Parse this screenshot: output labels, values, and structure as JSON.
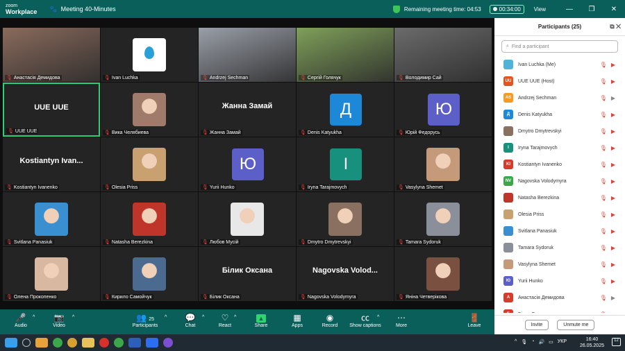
{
  "window": {
    "logo_line1": "zoom",
    "logo_line2": "Workplace",
    "meeting_title": "Meeting 40-Minutes",
    "remaining_label": "Remaining meeting time: 04:53",
    "elapsed": "00:34:00",
    "view_label": "View"
  },
  "tiles": [
    {
      "name": "Анастасія Демидова",
      "type": "video",
      "bg": "#8a6b5c"
    },
    {
      "name": "Ivan Luchka",
      "type": "logo",
      "bg": "#ffffff"
    },
    {
      "name": "Andrzej Sechman",
      "type": "video",
      "bg": "#9a9fa8"
    },
    {
      "name": "Сергій Голячук",
      "type": "video",
      "bg": "#7fa05a"
    },
    {
      "name": "Володимир Сай",
      "type": "video",
      "bg": "#6b6b6b"
    },
    {
      "name": "UUE UUE",
      "type": "text",
      "big": "UUE UUE",
      "active": true
    },
    {
      "name": "Вика Челябиева",
      "type": "photo",
      "bg": "#a07a6a"
    },
    {
      "name": "Жанна Замай",
      "type": "text",
      "big": "Жанна Замай"
    },
    {
      "name": "Denis Katyukha",
      "type": "letter",
      "letter": "Д",
      "bg": "#1e88d8"
    },
    {
      "name": "Юрій Федорусь",
      "type": "letter",
      "letter": "Ю",
      "bg": "#5b5fc7"
    },
    {
      "name": "Kostiantyn Ivanenko",
      "type": "text",
      "big": "Kostiantyn  Ivan..."
    },
    {
      "name": "Olesia Priss",
      "type": "photo",
      "bg": "#c9a070"
    },
    {
      "name": "Yurii Hunko",
      "type": "letter",
      "letter": "Ю",
      "bg": "#5b5fc7"
    },
    {
      "name": "Iryna Tarajmovych",
      "type": "letter",
      "letter": "І",
      "bg": "#17907e"
    },
    {
      "name": "Vasylyna Shemet",
      "type": "photo",
      "bg": "#c49a7a"
    },
    {
      "name": "Svitlana Panasiuk",
      "type": "photo",
      "bg": "#3a8fd0"
    },
    {
      "name": "Natasha Berezkina",
      "type": "photo",
      "bg": "#c0352a"
    },
    {
      "name": "Любов Мусій",
      "type": "photo",
      "bg": "#e8e8e8"
    },
    {
      "name": "Dmytro Dmytrevskyi",
      "type": "photo",
      "bg": "#8a7060"
    },
    {
      "name": "Tamara Sydoruk",
      "type": "photo",
      "bg": "#8a8f99"
    },
    {
      "name": "Олена Прокопенко",
      "type": "photo",
      "bg": "#d8b8a0"
    },
    {
      "name": "Кирило Самойчук",
      "type": "photo",
      "bg": "#4a6a90"
    },
    {
      "name": "Білик Оксана",
      "type": "text",
      "big": "Білик Оксана"
    },
    {
      "name": "Nagovska Volodymyra",
      "type": "text",
      "big": "Nagovska  Volod..."
    },
    {
      "name": "Яніна Четверікова",
      "type": "photo",
      "bg": "#7a5040"
    }
  ],
  "toolbar": {
    "audio": "Audio",
    "video": "Video",
    "participants": "Participants",
    "participants_count": "25",
    "chat": "Chat",
    "react": "React",
    "share": "Share",
    "apps": "Apps",
    "record": "Record",
    "captions": "Show captions",
    "more": "More",
    "leave": "Leave"
  },
  "panel": {
    "title": "Participants (25)",
    "search_placeholder": "Find a participant",
    "invite": "Invite",
    "unmute_me": "Unmute me",
    "participants": [
      {
        "name": "Ivan Luchka (Me)",
        "abbr": "",
        "color": "#4fb3d9",
        "video": "off"
      },
      {
        "name": "UUE UUE (Host)",
        "abbr": "UU",
        "color": "#e2551f",
        "video": "off"
      },
      {
        "name": "Andrzej Sechman",
        "abbr": "AS",
        "color": "#f59a23",
        "video": "on"
      },
      {
        "name": "Denis Katyukha",
        "abbr": "Д",
        "color": "#1e88d8",
        "video": "off"
      },
      {
        "name": "Dmytro Dmytrevskyi",
        "abbr": "",
        "color": "#8a7060",
        "video": "off"
      },
      {
        "name": "Iryna Tarajmovych",
        "abbr": "І",
        "color": "#17907e",
        "video": "off"
      },
      {
        "name": "Kostiantyn Ivanenko",
        "abbr": "KI",
        "color": "#d63a2a",
        "video": "off"
      },
      {
        "name": "Nagovska Volodymyra",
        "abbr": "NV",
        "color": "#3aa84a",
        "video": "off"
      },
      {
        "name": "Natasha Berezkina",
        "abbr": "",
        "color": "#c0352a",
        "video": "off"
      },
      {
        "name": "Olesia Priss",
        "abbr": "",
        "color": "#c9a070",
        "video": "off"
      },
      {
        "name": "Svitlana Panasiuk",
        "abbr": "",
        "color": "#3a8fd0",
        "video": "off"
      },
      {
        "name": "Tamara Sydoruk",
        "abbr": "",
        "color": "#8a8f99",
        "video": "off"
      },
      {
        "name": "Vasylyna Shemet",
        "abbr": "",
        "color": "#c49a7a",
        "video": "off"
      },
      {
        "name": "Yurii Hunko",
        "abbr": "Ю",
        "color": "#5b5fc7",
        "video": "off"
      },
      {
        "name": "Анастасія Демидова",
        "abbr": "А",
        "color": "#d63a2a",
        "video": "on"
      },
      {
        "name": "Білик Оксана",
        "abbr": "Б",
        "color": "#d63a2a",
        "video": "off"
      }
    ]
  },
  "taskbar": {
    "lang": "УКР",
    "time": "16:40",
    "date": "26.05.2025",
    "notifications": "12"
  }
}
